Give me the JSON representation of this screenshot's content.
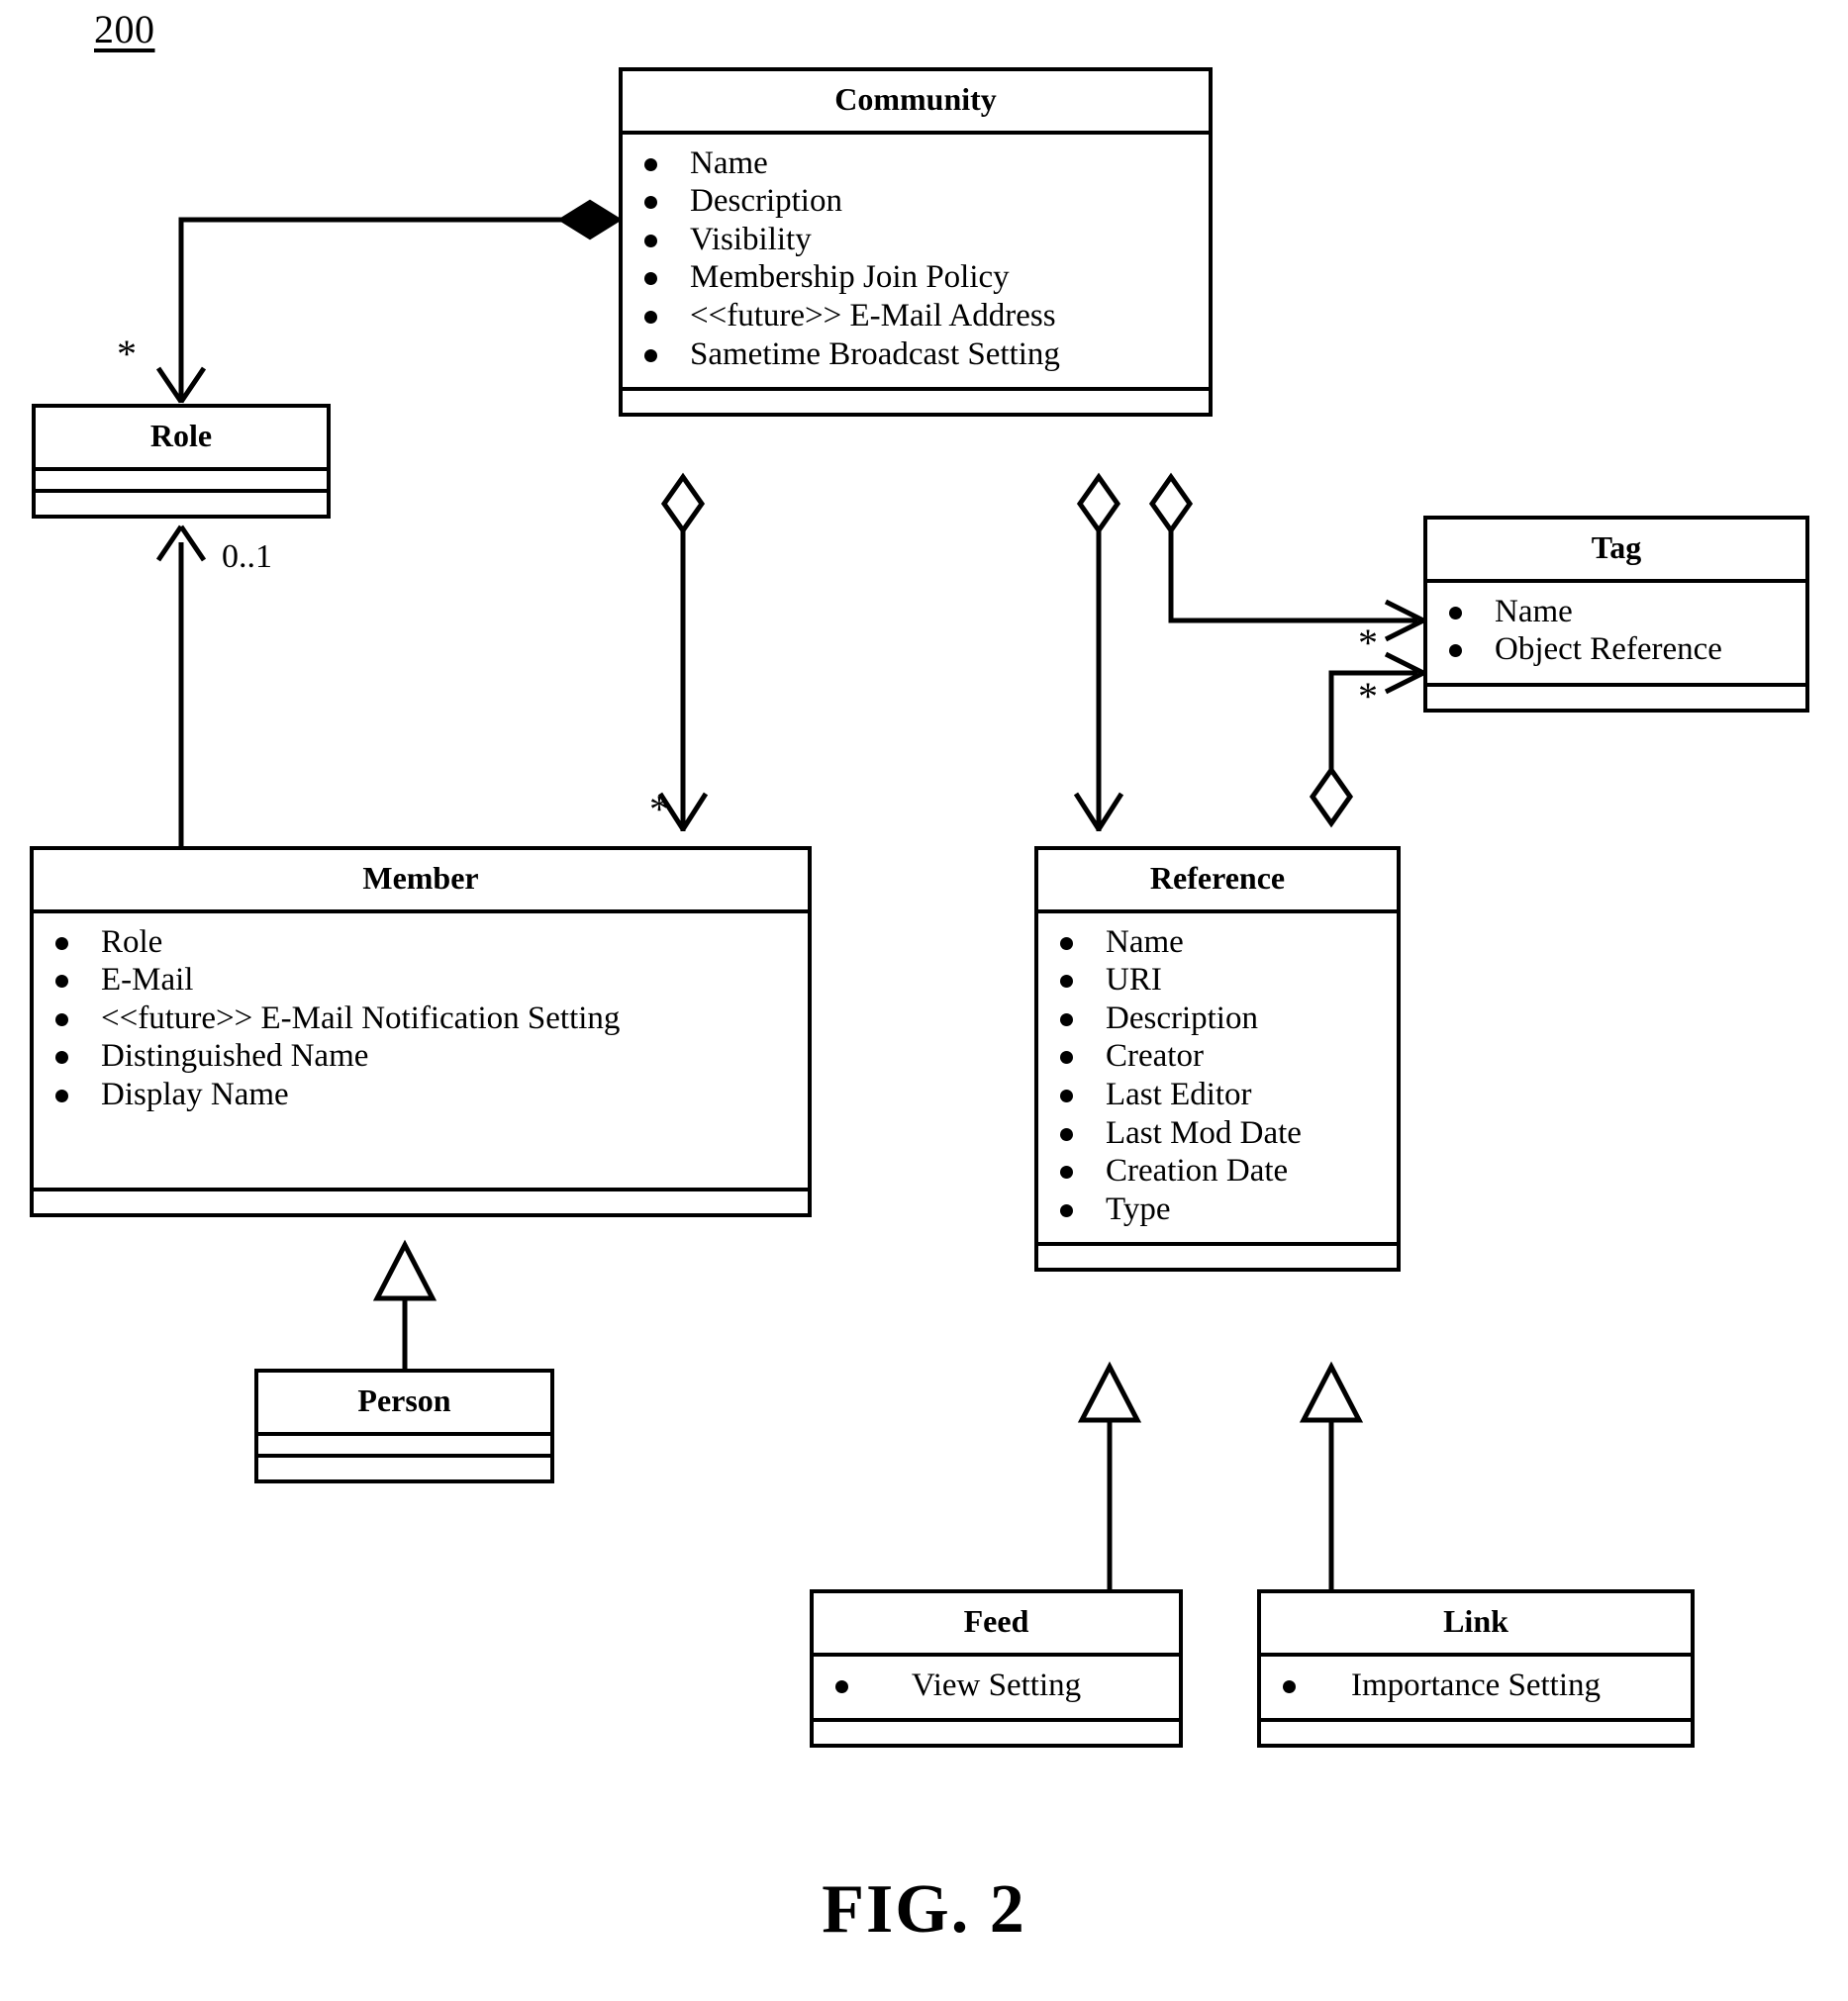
{
  "figure": {
    "number": "200",
    "caption": "FIG. 2"
  },
  "classes": {
    "community": {
      "name": "Community",
      "attributes": [
        "Name",
        "Description",
        "Visibility",
        "Membership Join Policy",
        "<<future>> E-Mail Address",
        "Sametime Broadcast Setting"
      ]
    },
    "role": {
      "name": "Role",
      "attributes": []
    },
    "tag": {
      "name": "Tag",
      "attributes": [
        "Name",
        "Object Reference"
      ]
    },
    "member": {
      "name": "Member",
      "attributes": [
        "Role",
        "E-Mail",
        "<<future>> E-Mail Notification Setting",
        "Distinguished Name",
        "Display Name"
      ]
    },
    "reference": {
      "name": "Reference",
      "attributes": [
        "Name",
        "URI",
        "Description",
        "Creator",
        "Last Editor",
        "Last Mod Date",
        "Creation Date",
        "Type"
      ]
    },
    "person": {
      "name": "Person",
      "attributes": []
    },
    "feed": {
      "name": "Feed",
      "attributes": [
        "View Setting"
      ]
    },
    "link": {
      "name": "Link",
      "attributes": [
        "Importance Setting"
      ]
    }
  },
  "multiplicities": {
    "community_role": "*",
    "member_role": "0..1",
    "community_member": "*",
    "community_tag": "*",
    "reference_tag": "*"
  },
  "relationships": [
    {
      "from": "Community",
      "to": "Role",
      "type": "composition",
      "multiplicity": "*"
    },
    {
      "from": "Member",
      "to": "Role",
      "type": "association",
      "multiplicity": "0..1"
    },
    {
      "from": "Community",
      "to": "Member",
      "type": "aggregation",
      "multiplicity": "*"
    },
    {
      "from": "Community",
      "to": "Reference",
      "type": "aggregation",
      "multiplicity": ""
    },
    {
      "from": "Community",
      "to": "Tag",
      "type": "aggregation",
      "multiplicity": "*"
    },
    {
      "from": "Reference",
      "to": "Tag",
      "type": "aggregation",
      "multiplicity": "*"
    },
    {
      "from": "Person",
      "to": "Member",
      "type": "generalization",
      "multiplicity": ""
    },
    {
      "from": "Feed",
      "to": "Reference",
      "type": "generalization",
      "multiplicity": ""
    },
    {
      "from": "Link",
      "to": "Reference",
      "type": "generalization",
      "multiplicity": ""
    }
  ],
  "colors": {
    "stroke": "#000000",
    "background": "#ffffff"
  }
}
